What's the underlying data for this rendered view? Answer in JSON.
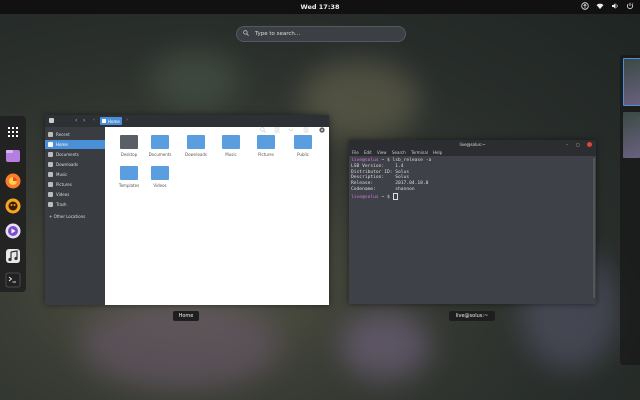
{
  "topbar": {
    "clock": "Wed 17:38"
  },
  "search": {
    "placeholder": "Type to search…"
  },
  "dash": {
    "items": [
      {
        "name": "app-grid",
        "color": "#2a2a2a"
      },
      {
        "name": "files",
        "color": "#b57fe0"
      },
      {
        "name": "firefox",
        "color": "#ff7b2e"
      },
      {
        "name": "hexchat",
        "color": "#f5a623"
      },
      {
        "name": "rhythmbox",
        "color": "#7b4fc9"
      },
      {
        "name": "music",
        "color": "#e8e8e8"
      },
      {
        "name": "terminal",
        "color": "#222222"
      }
    ]
  },
  "file_manager": {
    "path_button": "Home",
    "sidebar": [
      {
        "label": "Recent"
      },
      {
        "label": "Home"
      },
      {
        "label": "Documents"
      },
      {
        "label": "Downloads"
      },
      {
        "label": "Music"
      },
      {
        "label": "Pictures"
      },
      {
        "label": "Videos"
      },
      {
        "label": "Trash"
      },
      {
        "label": "+ Other Locations"
      }
    ],
    "files": [
      {
        "label": "Desktop",
        "color": "#5a5f66"
      },
      {
        "label": "Documents",
        "color": "#5a9ee0"
      },
      {
        "label": "Downloads",
        "color": "#5a9ee0"
      },
      {
        "label": "Music",
        "color": "#5a9ee0"
      },
      {
        "label": "Pictures",
        "color": "#5a9ee0"
      },
      {
        "label": "Public",
        "color": "#5a9ee0"
      },
      {
        "label": "Templates",
        "color": "#5a9ee0"
      },
      {
        "label": "Videos",
        "color": "#5a9ee0"
      }
    ]
  },
  "terminal": {
    "title": "live@solus:~",
    "menu": [
      "File",
      "Edit",
      "View",
      "Search",
      "Terminal",
      "Help"
    ],
    "prompt1": "live@solus",
    "cmd1": " ~ $ lsb_release -a",
    "output": "LSB Version:    1.4\nDistributor ID: Solus\nDescription:    Solus\nRelease:        2017.04.18.0\nCodename:       shannon",
    "prompt2": "live@solus",
    "cmd2": " ~ $ "
  },
  "captions": {
    "file_manager": "Home",
    "terminal": "live@solus:~"
  }
}
